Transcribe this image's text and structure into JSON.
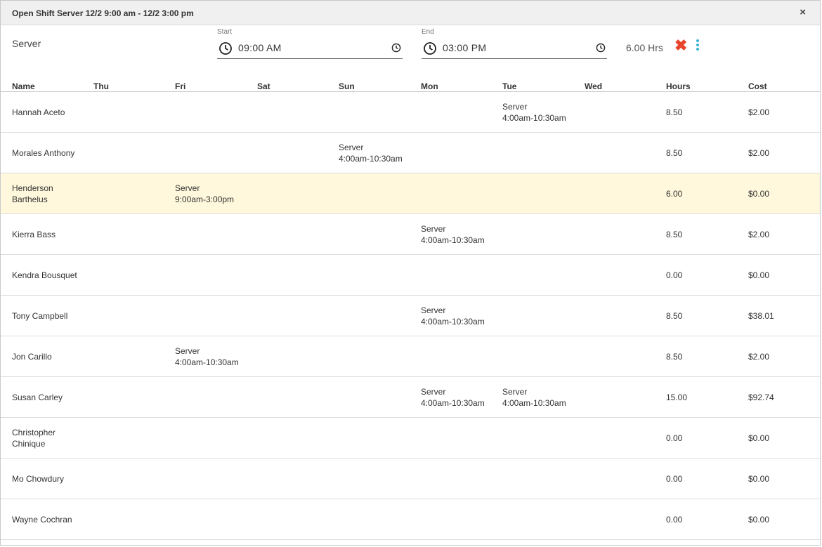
{
  "dialog": {
    "title": "Open Shift Server 12/2 9:00 am - 12/2 3:00 pm",
    "close_label": "×"
  },
  "shift": {
    "role": "Server",
    "start": {
      "label": "Start",
      "value": "09:00 AM"
    },
    "end": {
      "label": "End",
      "value": "03:00 PM"
    },
    "hours": "6.00 Hrs",
    "delete_icon": "✖",
    "accent_color": "#3ab1d3",
    "delete_color": "#e8452c"
  },
  "table": {
    "columns": [
      "Name",
      "Thu",
      "Fri",
      "Sat",
      "Sun",
      "Mon",
      "Tue",
      "Wed",
      "Hours",
      "Cost"
    ],
    "rows": [
      {
        "name": "Hannah Aceto",
        "thu": "",
        "fri": "",
        "sat": "",
        "sun": "",
        "mon": "",
        "tue": "Server\n4:00am-10:30am",
        "wed": "",
        "hours": "8.50",
        "cost": "$2.00"
      },
      {
        "name": "Morales Anthony",
        "thu": "",
        "fri": "",
        "sat": "",
        "sun": "Server\n4:00am-10:30am",
        "mon": "",
        "tue": "",
        "wed": "",
        "hours": "8.50",
        "cost": "$2.00"
      },
      {
        "name": "Henderson\nBarthelus",
        "thu": "",
        "fri": "Server\n9:00am-3:00pm",
        "sat": "",
        "sun": "",
        "mon": "",
        "tue": "",
        "wed": "",
        "hours": "6.00",
        "cost": "$0.00",
        "highlight": true
      },
      {
        "name": "Kierra Bass",
        "thu": "",
        "fri": "",
        "sat": "",
        "sun": "",
        "mon": "Server\n4:00am-10:30am",
        "tue": "",
        "wed": "",
        "hours": "8.50",
        "cost": "$2.00"
      },
      {
        "name": "Kendra Bousquet",
        "thu": "",
        "fri": "",
        "sat": "",
        "sun": "",
        "mon": "",
        "tue": "",
        "wed": "",
        "hours": "0.00",
        "cost": "$0.00"
      },
      {
        "name": "Tony Campbell",
        "thu": "",
        "fri": "",
        "sat": "",
        "sun": "",
        "mon": "Server\n4:00am-10:30am",
        "tue": "",
        "wed": "",
        "hours": "8.50",
        "cost": "$38.01"
      },
      {
        "name": "Jon Carillo",
        "thu": "",
        "fri": "Server\n4:00am-10:30am",
        "sat": "",
        "sun": "",
        "mon": "",
        "tue": "",
        "wed": "",
        "hours": "8.50",
        "cost": "$2.00"
      },
      {
        "name": "Susan Carley",
        "thu": "",
        "fri": "",
        "sat": "",
        "sun": "",
        "mon": "Server\n4:00am-10:30am",
        "tue": "Server\n4:00am-10:30am",
        "wed": "",
        "hours": "15.00",
        "cost": "$92.74"
      },
      {
        "name": "Christopher\nChinique",
        "thu": "",
        "fri": "",
        "sat": "",
        "sun": "",
        "mon": "",
        "tue": "",
        "wed": "",
        "hours": "0.00",
        "cost": "$0.00"
      },
      {
        "name": "Mo Chowdury",
        "thu": "",
        "fri": "",
        "sat": "",
        "sun": "",
        "mon": "",
        "tue": "",
        "wed": "",
        "hours": "0.00",
        "cost": "$0.00"
      },
      {
        "name": "Wayne Cochran",
        "thu": "",
        "fri": "",
        "sat": "",
        "sun": "",
        "mon": "",
        "tue": "",
        "wed": "",
        "hours": "0.00",
        "cost": "$0.00"
      }
    ]
  }
}
